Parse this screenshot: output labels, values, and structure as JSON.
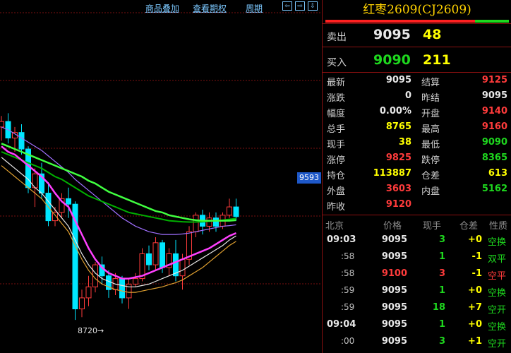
{
  "toolbar": {
    "overlay": "商品叠加",
    "ex_rights": "查看期权",
    "period": "周期",
    "nav1": "⇦",
    "nav2": "⇨",
    "nav3": "⇩"
  },
  "chart": {
    "price_tag": "9593",
    "low_label": "8720→"
  },
  "title": "红枣2609(CJ2609)",
  "quotes": {
    "sell_label": "卖出",
    "sell_price": "9095",
    "sell_vol": "48",
    "buy_label": "买入",
    "buy_price": "9090",
    "buy_vol": "211"
  },
  "stats": [
    {
      "l1": "最新",
      "v1": "9095",
      "c1": "#e8e8e8",
      "l2": "结算",
      "v2": "9125",
      "c2": "#ff3b3b"
    },
    {
      "l1": "涨跌",
      "v1": "0",
      "c1": "#e8e8e8",
      "l2": "昨结",
      "v2": "9095",
      "c2": "#e8e8e8"
    },
    {
      "l1": "幅度",
      "v1": "0.00%",
      "c1": "#e8e8e8",
      "l2": "开盘",
      "v2": "9140",
      "c2": "#ff3b3b"
    },
    {
      "l1": "总手",
      "v1": "8765",
      "c1": "#ffff00",
      "l2": "最高",
      "v2": "9160",
      "c2": "#ff3b3b"
    },
    {
      "l1": "现手",
      "v1": "38",
      "c1": "#ffff00",
      "l2": "最低",
      "v2": "9090",
      "c2": "#1ed71e"
    },
    {
      "l1": "涨停",
      "v1": "9825",
      "c1": "#ff3b3b",
      "l2": "跌停",
      "v2": "8365",
      "c2": "#1ed71e"
    },
    {
      "l1": "持仓",
      "v1": "113887",
      "c1": "#ffff00",
      "l2": "仓差",
      "v2": "613",
      "c2": "#ffff00"
    },
    {
      "l1": "外盘",
      "v1": "3603",
      "c1": "#ff3b3b",
      "l2": "内盘",
      "v2": "5162",
      "c2": "#1ed71e"
    },
    {
      "l1": "昨收",
      "v1": "9120",
      "c1": "#ff3b3b",
      "l2": "",
      "v2": "",
      "c2": "#e8e8e8"
    }
  ],
  "ticks_header": {
    "time": "北京",
    "price": "价格",
    "vol": "现手",
    "oi": "仓差",
    "nature": "性质"
  },
  "ticks": [
    {
      "time": "09:03",
      "price": "9095",
      "pc": "#e8e8e8",
      "vol": "3",
      "vc": "#1ed71e",
      "oi": "+0",
      "oc": "#ffff00",
      "nat": "空换",
      "nc": "#1ed71e"
    },
    {
      "time": ":58",
      "price": "9095",
      "pc": "#e8e8e8",
      "vol": "1",
      "vc": "#1ed71e",
      "oi": "-1",
      "oc": "#ffff00",
      "nat": "双平",
      "nc": "#1ed71e"
    },
    {
      "time": ":58",
      "price": "9100",
      "pc": "#ff3b3b",
      "vol": "3",
      "vc": "#ff3b3b",
      "oi": "-1",
      "oc": "#ffff00",
      "nat": "空平",
      "nc": "#ff3b3b"
    },
    {
      "time": ":59",
      "price": "9095",
      "pc": "#e8e8e8",
      "vol": "1",
      "vc": "#1ed71e",
      "oi": "+0",
      "oc": "#ffff00",
      "nat": "空换",
      "nc": "#1ed71e"
    },
    {
      "time": ":59",
      "price": "9095",
      "pc": "#e8e8e8",
      "vol": "18",
      "vc": "#1ed71e",
      "oi": "+7",
      "oc": "#ffff00",
      "nat": "空开",
      "nc": "#1ed71e"
    },
    {
      "time": "09:04",
      "price": "9095",
      "pc": "#e8e8e8",
      "vol": "1",
      "vc": "#1ed71e",
      "oi": "+0",
      "oc": "#ffff00",
      "nat": "空换",
      "nc": "#1ed71e"
    },
    {
      "time": ":00",
      "price": "9095",
      "pc": "#e8e8e8",
      "vol": "3",
      "vc": "#1ed71e",
      "oi": "+1",
      "oc": "#ffff00",
      "nat": "空开",
      "nc": "#1ed71e"
    }
  ],
  "candles": [
    {
      "o": 9420,
      "h": 9460,
      "l": 9370,
      "c": 9440
    },
    {
      "o": 9440,
      "h": 9470,
      "l": 9360,
      "c": 9380
    },
    {
      "o": 9380,
      "h": 9420,
      "l": 9330,
      "c": 9400
    },
    {
      "o": 9400,
      "h": 9430,
      "l": 9320,
      "c": 9340
    },
    {
      "o": 9340,
      "h": 9350,
      "l": 9180,
      "c": 9200
    },
    {
      "o": 9200,
      "h": 9270,
      "l": 9130,
      "c": 9250
    },
    {
      "o": 9250,
      "h": 9290,
      "l": 9160,
      "c": 9180
    },
    {
      "o": 9180,
      "h": 9220,
      "l": 9060,
      "c": 9080
    },
    {
      "o": 9080,
      "h": 9130,
      "l": 9060,
      "c": 9110
    },
    {
      "o": 9110,
      "h": 9180,
      "l": 9090,
      "c": 9160
    },
    {
      "o": 9160,
      "h": 9200,
      "l": 9090,
      "c": 9140
    },
    {
      "o": 9140,
      "h": 9150,
      "l": 8720,
      "c": 8760
    },
    {
      "o": 8760,
      "h": 8830,
      "l": 8730,
      "c": 8800
    },
    {
      "o": 8800,
      "h": 8880,
      "l": 8770,
      "c": 8840
    },
    {
      "o": 8840,
      "h": 8930,
      "l": 8820,
      "c": 8920
    },
    {
      "o": 8920,
      "h": 8950,
      "l": 8850,
      "c": 8880
    },
    {
      "o": 8880,
      "h": 8900,
      "l": 8800,
      "c": 8830
    },
    {
      "o": 8830,
      "h": 8890,
      "l": 8810,
      "c": 8870
    },
    {
      "o": 8870,
      "h": 8880,
      "l": 8780,
      "c": 8800
    },
    {
      "o": 8800,
      "h": 8870,
      "l": 8760,
      "c": 8850
    },
    {
      "o": 8850,
      "h": 8890,
      "l": 8840,
      "c": 8870
    },
    {
      "o": 8870,
      "h": 8980,
      "l": 8860,
      "c": 8960
    },
    {
      "o": 8960,
      "h": 8990,
      "l": 8900,
      "c": 8920
    },
    {
      "o": 8920,
      "h": 9020,
      "l": 8900,
      "c": 9000
    },
    {
      "o": 9000,
      "h": 9010,
      "l": 8890,
      "c": 8910
    },
    {
      "o": 8910,
      "h": 8980,
      "l": 8880,
      "c": 8960
    },
    {
      "o": 8960,
      "h": 9010,
      "l": 8860,
      "c": 8880
    },
    {
      "o": 8880,
      "h": 8960,
      "l": 8830,
      "c": 8940
    },
    {
      "o": 8940,
      "h": 9060,
      "l": 8920,
      "c": 9040
    },
    {
      "o": 9040,
      "h": 9110,
      "l": 9020,
      "c": 9100
    },
    {
      "o": 9100,
      "h": 9120,
      "l": 9030,
      "c": 9060
    },
    {
      "o": 9060,
      "h": 9110,
      "l": 9040,
      "c": 9090
    },
    {
      "o": 9090,
      "h": 9110,
      "l": 9040,
      "c": 9060
    },
    {
      "o": 9060,
      "h": 9110,
      "l": 9050,
      "c": 9100
    },
    {
      "o": 9100,
      "h": 9160,
      "l": 9090,
      "c": 9130
    },
    {
      "o": 9130,
      "h": 9160,
      "l": 9080,
      "c": 9095
    }
  ],
  "ma_green": [
    9330,
    9320,
    9310,
    9300,
    9290,
    9280,
    9270,
    9255,
    9240,
    9230,
    9215,
    9200,
    9185,
    9170,
    9160,
    9150,
    9140,
    9130,
    9120,
    9110,
    9105,
    9100,
    9095,
    9090,
    9085,
    9080,
    9078,
    9076,
    9075,
    9075,
    9076,
    9078,
    9080,
    9082,
    9085,
    9088
  ],
  "ma_lime": [
    9360,
    9350,
    9340,
    9330,
    9320,
    9310,
    9300,
    9290,
    9280,
    9270,
    9260,
    9250,
    9240,
    9225,
    9215,
    9200,
    9185,
    9175,
    9165,
    9155,
    9145,
    9135,
    9125,
    9115,
    9110,
    9100,
    9095,
    9090,
    9085,
    9082,
    9080,
    9080,
    9080,
    9080,
    9080,
    9082
  ],
  "ma_purple": [
    9420,
    9410,
    9395,
    9380,
    9365,
    9350,
    9335,
    9315,
    9295,
    9275,
    9255,
    9230,
    9210,
    9190,
    9170,
    9150,
    9130,
    9110,
    9090,
    9075,
    9060,
    9050,
    9040,
    9035,
    9030,
    9030,
    9030,
    9032,
    9035,
    9040,
    9045,
    9050,
    9055,
    9060,
    9062,
    9065
  ],
  "ma_magenta": [
    9350,
    9330,
    9320,
    9300,
    9280,
    9260,
    9240,
    9215,
    9180,
    9150,
    9130,
    9080,
    9030,
    8980,
    8940,
    8910,
    8890,
    8880,
    8870,
    8870,
    8875,
    8880,
    8890,
    8900,
    8910,
    8920,
    8930,
    8940,
    8950,
    8960,
    8970,
    8980,
    8995,
    9010,
    9025,
    9035
  ],
  "ma_white": [
    9310,
    9290,
    9270,
    9250,
    9230,
    9200,
    9180,
    9150,
    9120,
    9090,
    9060,
    9010,
    8960,
    8920,
    8890,
    8870,
    8860,
    8850,
    8845,
    8840,
    8840,
    8845,
    8850,
    8860,
    8870,
    8880,
    8890,
    8900,
    8915,
    8930,
    8945,
    8960,
    8975,
    8990,
    9010,
    9025
  ],
  "ma_orange": [
    9280,
    9260,
    9240,
    9220,
    9200,
    9180,
    9160,
    9130,
    9100,
    9070,
    9040,
    8990,
    8940,
    8900,
    8870,
    8850,
    8840,
    8830,
    8825,
    8820,
    8820,
    8825,
    8830,
    8835,
    8840,
    8848,
    8855,
    8865,
    8880,
    8895,
    8910,
    8930,
    8950,
    8970,
    8990,
    9005
  ]
}
